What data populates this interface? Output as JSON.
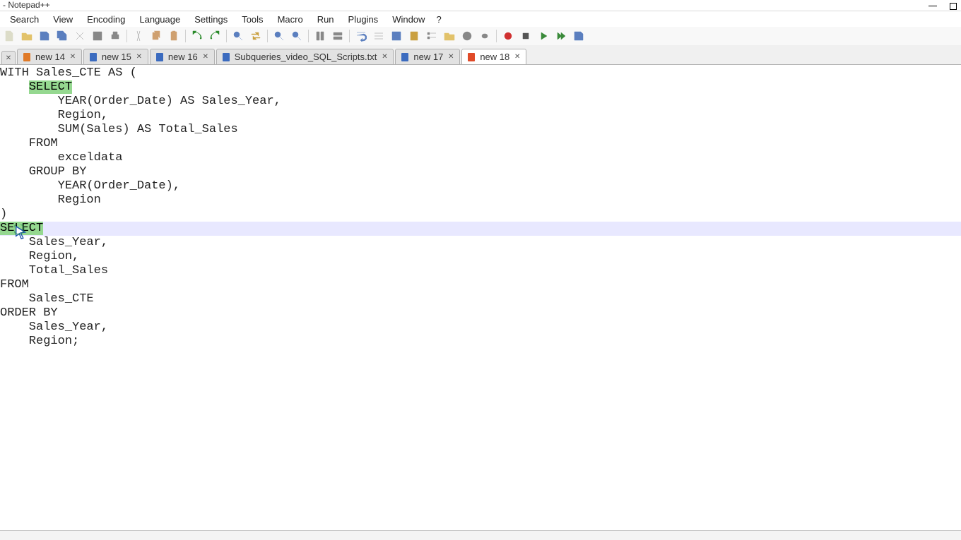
{
  "title": "- Notepad++",
  "menu": {
    "items": [
      "Search",
      "View",
      "Encoding",
      "Language",
      "Settings",
      "Tools",
      "Macro",
      "Run",
      "Plugins",
      "Window",
      "?"
    ]
  },
  "toolbar": {
    "buttons": [
      "new-file",
      "open-file",
      "save",
      "save-all",
      "close",
      "close-all",
      "print",
      "cut",
      "copy",
      "paste",
      "undo",
      "redo",
      "find",
      "replace",
      "zoom-in",
      "zoom-out",
      "sync-v",
      "sync-h",
      "word-wrap",
      "all-chars",
      "indent-guide",
      "doc-map",
      "func-list",
      "folder-as-workspace",
      "monitoring",
      "link",
      "record-macro",
      "stop-macro",
      "play-macro",
      "play-multi",
      "save-macro"
    ]
  },
  "tabs": [
    {
      "label": "new 14",
      "icon": "unsaved",
      "active": false
    },
    {
      "label": "new 15",
      "icon": "saved",
      "active": false
    },
    {
      "label": "new 16",
      "icon": "saved",
      "active": false
    },
    {
      "label": "Subqueries_video_SQL_Scripts.txt",
      "icon": "saved",
      "active": false
    },
    {
      "label": "new 17",
      "icon": "saved",
      "active": false
    },
    {
      "label": "new 18",
      "icon": "active-unsaved",
      "active": true
    }
  ],
  "editor": {
    "highlight_word": "SELECT",
    "cursor_line_index": 11,
    "lines": [
      "WITH Sales_CTE AS (",
      "    SELECT",
      "        YEAR(Order_Date) AS Sales_Year,",
      "        Region,",
      "        SUM(Sales) AS Total_Sales",
      "    FROM",
      "        exceldata",
      "    GROUP BY",
      "        YEAR(Order_Date),",
      "        Region",
      ")",
      "SELECT",
      "    Sales_Year,",
      "    Region,",
      "    Total_Sales",
      "FROM",
      "    Sales_CTE",
      "ORDER BY",
      "    Sales_Year,",
      "    Region;"
    ]
  }
}
